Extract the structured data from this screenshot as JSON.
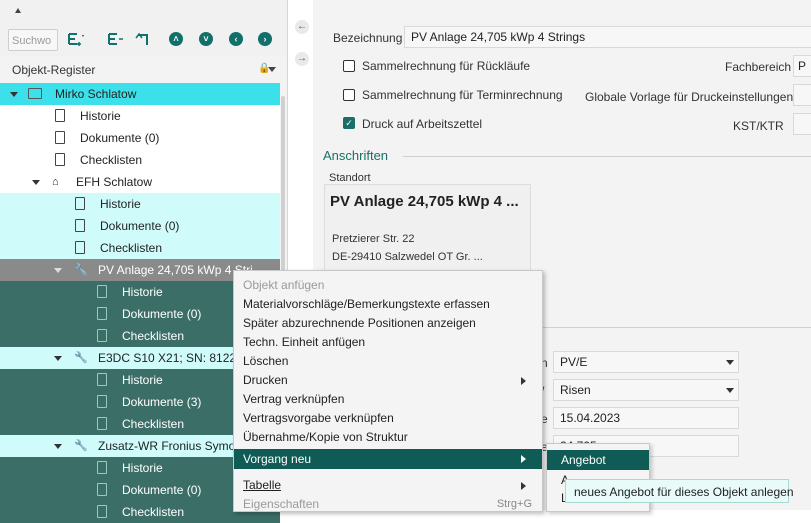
{
  "toolbar": {
    "search_placeholder": "Suchwo",
    "icons": [
      "add-dropdown-icon",
      "indent-icon",
      "undo-icon",
      "chevron-up-icon",
      "chevron-down-icon",
      "chevron-left-icon",
      "chevron-right-icon"
    ]
  },
  "register": {
    "title": "Objekt-Register"
  },
  "tree": {
    "root": "Mirko Schlatow",
    "r_hist": "Historie",
    "r_docs": "Dokumente (0)",
    "r_check": "Checklisten",
    "efh": "EFH Schlatow",
    "e_hist": "Historie",
    "e_docs": "Dokumente (0)",
    "e_check": "Checklisten",
    "pv": "PV Anlage 24,705 kWp 4 Stri",
    "pv_hist": "Historie",
    "pv_docs": "Dokumente (0)",
    "pv_check": "Checklisten",
    "e3dc": "E3DC S10 X21; SN: 8122-",
    "e3_hist": "Historie",
    "e3_docs": "Dokumente (3)",
    "e3_check": "Checklisten",
    "wr": "Zusatz-WR Fronius Symo",
    "wr_hist": "Historie",
    "wr_docs": "Dokumente (0)",
    "wr_check": "Checklisten"
  },
  "form": {
    "bezeichnung_label": "Bezeichnung",
    "bezeichnung_value": "PV Anlage 24,705 kWp 4 Strings",
    "chk1_label": "Sammelrechnung für Rückläufe",
    "chk1_checked": false,
    "chk2_label": "Sammelrechnung für Terminrechnung",
    "chk2_checked": false,
    "chk3_label": "Druck auf Arbeitszettel",
    "chk3_checked": true,
    "fachbereich_label": "Fachbereich",
    "fachbereich_value": "P",
    "globale_label": "Globale Vorlage für Druckeinstellungen",
    "kst_label": "KST/KTR",
    "anschriften_label": "Anschriften",
    "standort_label": "Standort",
    "standort_name": "PV Anlage 24,705 kWp 4 ...",
    "street": "Pretzierer Str. 22",
    "city": "DE-29410 Salzwedel OT Gr. ...",
    "field1_partial_label": "n",
    "field1_value": "PV/E",
    "field2_partial_label": "/",
    "field2_value": "Risen",
    "field3_partial_label": "e",
    "field3_value": "15.04.2023",
    "field4_partial_label": "e",
    "field4_value": "24,705"
  },
  "context_menu": {
    "item0": "Objekt anfügen",
    "item1": "Materialvorschläge/Bemerkungstexte erfassen",
    "item2": "Später abzurechnende Positionen anzeigen",
    "item3": "Techn. Einheit anfügen",
    "item4": "Löschen",
    "item5": "Drucken",
    "item6": "Vertrag verknüpfen",
    "item7": "Vertragsvorgabe verknüpfen",
    "item8": "Übernahme/Kopie von Struktur",
    "item9": "Vorgang neu",
    "item10": "Tabelle",
    "item11": "Eigenschaften",
    "item11_shortcut": "Strg+G"
  },
  "submenu": {
    "item0": "Angebot",
    "item1": "A",
    "item2": "L"
  },
  "tooltip": "neues Angebot für dieses Objekt anlegen",
  "colors": {
    "accent": "#0f5b55",
    "selected_cyan": "#3be0ea",
    "light_cyan": "#cffcfb",
    "dark_teal": "#3c6e68"
  }
}
